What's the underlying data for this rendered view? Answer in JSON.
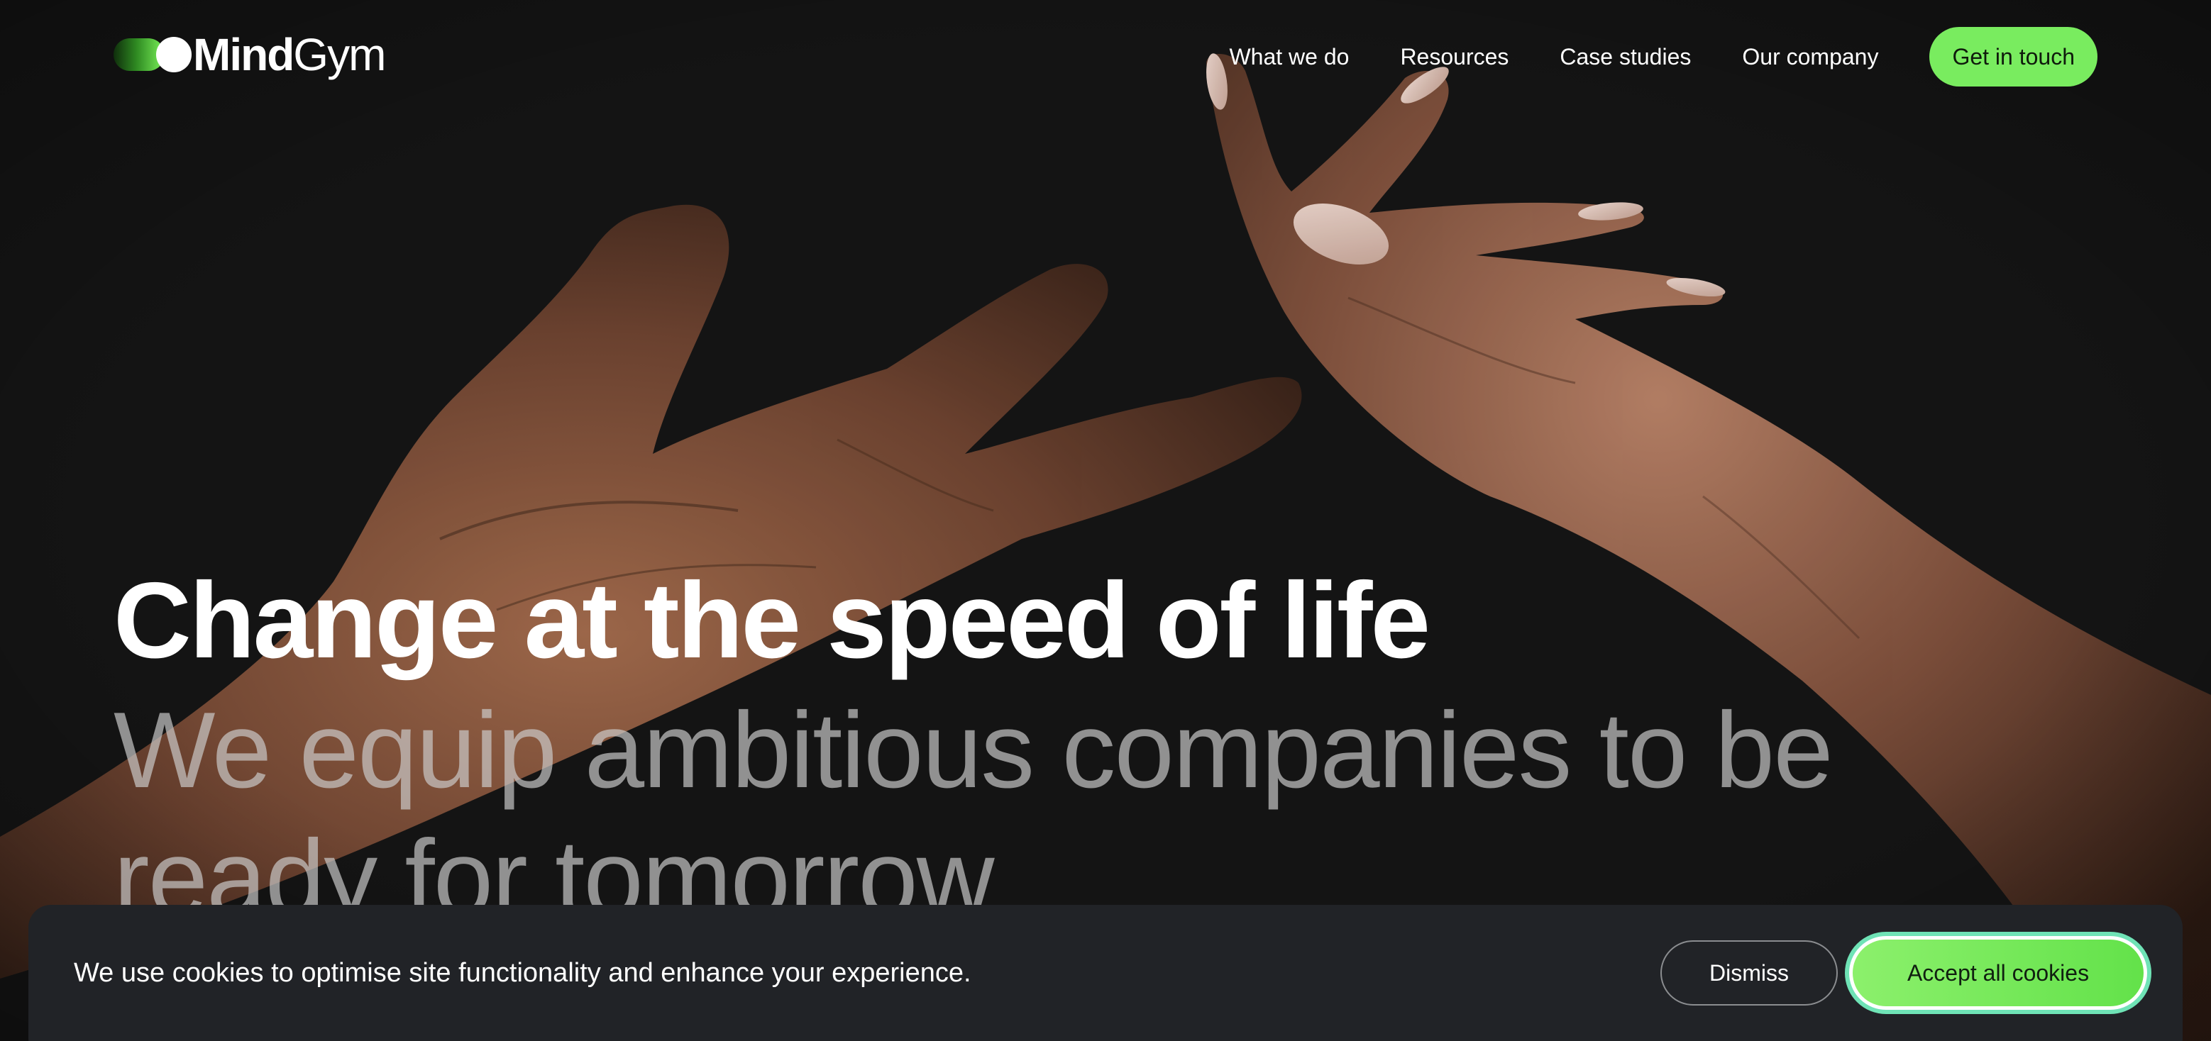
{
  "brand": {
    "logo_bold": "Mind",
    "logo_regular": "Gym",
    "accent_color": "#79ec5f"
  },
  "nav": {
    "items": [
      {
        "label": "What we do"
      },
      {
        "label": "Resources"
      },
      {
        "label": "Case studies"
      },
      {
        "label": "Our company"
      }
    ],
    "cta_label": "Get in touch"
  },
  "hero": {
    "title": "Change at the speed of life",
    "subtitle": "We equip ambitious companies to be ready for tomorrow",
    "background": "hands-reaching-photo"
  },
  "cookie_banner": {
    "message": "We use cookies to optimise site functionality and enhance your experience.",
    "dismiss_label": "Dismiss",
    "accept_label": "Accept all cookies"
  },
  "colors": {
    "page_background": "#141414",
    "banner_background": "#212327",
    "accept_focus_ring": "#6fe3b6"
  }
}
